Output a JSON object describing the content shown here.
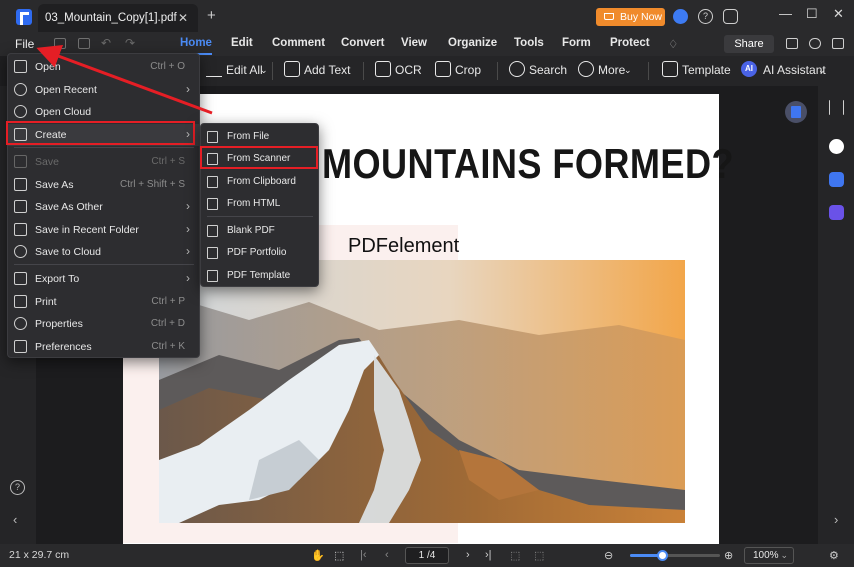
{
  "window": {
    "tab_title": "03_Mountain_Copy[1].pdf",
    "tab_close": "✕",
    "tab_add": "+",
    "buy_now": "Buy Now",
    "help_glyph": "?",
    "minimize": "—",
    "maximize": "☐",
    "close": "✕"
  },
  "menubar": {
    "file": "File",
    "items": [
      "Home",
      "Edit",
      "Comment",
      "Convert",
      "View",
      "Organize",
      "Tools",
      "Form",
      "Protect"
    ],
    "active": "Home",
    "share": "Share"
  },
  "toolbar": {
    "edit_all": "Edit All",
    "add_text": "Add Text",
    "ocr": "OCR",
    "crop": "Crop",
    "search": "Search",
    "more": "More",
    "template": "Template",
    "ai_badge": "AI",
    "ai_assistant": "AI Assistant"
  },
  "file_menu": {
    "items": [
      {
        "label": "Open",
        "shortcut": "Ctrl + O",
        "submenu": false,
        "disabled": false,
        "icon": "open-file-icon"
      },
      {
        "label": "Open Recent",
        "shortcut": "",
        "submenu": true,
        "disabled": false,
        "icon": "clock-icon"
      },
      {
        "label": "Open Cloud",
        "shortcut": "",
        "submenu": false,
        "disabled": false,
        "icon": "cloud-icon"
      },
      {
        "label": "Create",
        "shortcut": "",
        "submenu": true,
        "disabled": false,
        "icon": "create-icon"
      },
      {
        "label": "Save",
        "shortcut": "Ctrl + S",
        "submenu": false,
        "disabled": true,
        "icon": "save-icon"
      },
      {
        "label": "Save As",
        "shortcut": "Ctrl + Shift + S",
        "submenu": false,
        "disabled": false,
        "icon": "save-as-icon"
      },
      {
        "label": "Save As Other",
        "shortcut": "",
        "submenu": true,
        "disabled": false,
        "icon": "save-as-other-icon"
      },
      {
        "label": "Save in Recent Folder",
        "shortcut": "",
        "submenu": true,
        "disabled": false,
        "icon": "folder-icon"
      },
      {
        "label": "Save to Cloud",
        "shortcut": "",
        "submenu": true,
        "disabled": false,
        "icon": "cloud-upload-icon"
      },
      {
        "label": "Export To",
        "shortcut": "",
        "submenu": true,
        "disabled": false,
        "icon": "export-icon"
      },
      {
        "label": "Print",
        "shortcut": "Ctrl + P",
        "submenu": false,
        "disabled": false,
        "icon": "print-icon"
      },
      {
        "label": "Properties",
        "shortcut": "Ctrl + D",
        "submenu": false,
        "disabled": false,
        "icon": "properties-icon"
      },
      {
        "label": "Preferences",
        "shortcut": "Ctrl + K",
        "submenu": false,
        "disabled": false,
        "icon": "preferences-icon"
      }
    ]
  },
  "create_submenu": {
    "items": [
      {
        "label": "From File",
        "icon": "folder-icon"
      },
      {
        "label": "From Scanner",
        "icon": "scanner-icon"
      },
      {
        "label": "From Clipboard",
        "icon": "clipboard-icon"
      },
      {
        "label": "From HTML",
        "icon": "html-icon"
      },
      {
        "label": "Blank PDF",
        "icon": "blank-pdf-icon"
      },
      {
        "label": "PDF Portfolio",
        "icon": "portfolio-icon"
      },
      {
        "label": "PDF Template",
        "icon": "template-icon"
      }
    ]
  },
  "document": {
    "headline": "MOUNTAINS FORMED?",
    "watermark": "PDFelement"
  },
  "statusbar": {
    "page_size": "21 x 29.7 cm",
    "page": "1 /4",
    "zoom": "100%",
    "zoom_level": 0.35
  },
  "colors": {
    "accent": "#4b8bf5",
    "highlight": "#e51e25",
    "buy_now": "#f08b2c"
  }
}
